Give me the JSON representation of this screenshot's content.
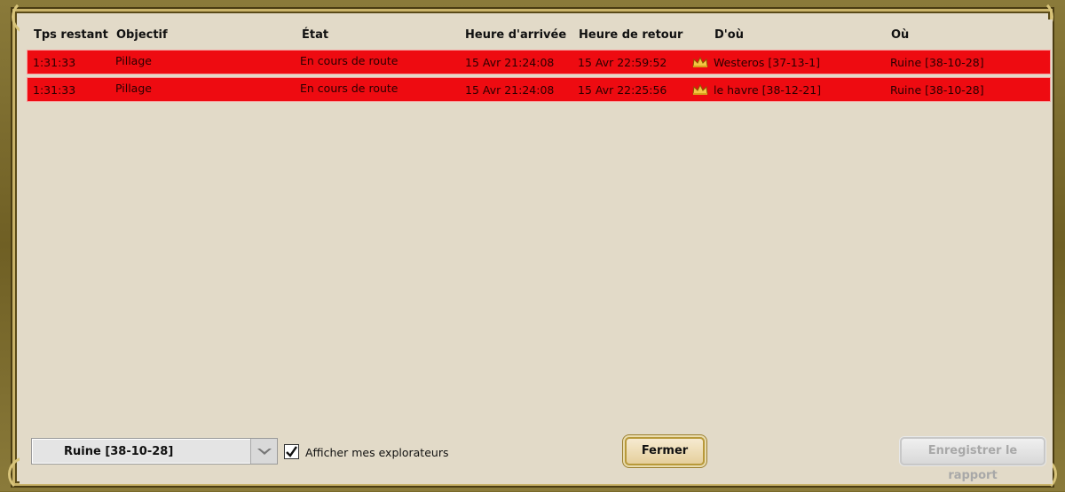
{
  "table": {
    "headers": {
      "tps": "Tps restant",
      "objectif": "Objectif",
      "etat": "État",
      "arrivee": "Heure d'arrivée",
      "retour": "Heure de retour",
      "from": "D'où",
      "to": "Où"
    },
    "rows": [
      {
        "tps": "1:31:33",
        "objectif": "Pillage",
        "etat": "En cours de route",
        "arrivee": "15 Avr 21:24:08",
        "retour": "15 Avr 22:59:52",
        "from": "Westeros [37-13-1]",
        "to": "Ruine [38-10-28]"
      },
      {
        "tps": "1:31:33",
        "objectif": "Pillage",
        "etat": "En cours de route",
        "arrivee": "15 Avr 21:24:08",
        "retour": "15 Avr 22:25:56",
        "from": "le havre [38-12-21]",
        "to": "Ruine [38-10-28]"
      }
    ],
    "row_color": "#ee0b11"
  },
  "footer": {
    "select_value": "Ruine [38-10-28]",
    "checkbox_label": "Afficher mes explorateurs",
    "checkbox_checked": true,
    "close_label": "Fermer",
    "report_label": "Enregistrer le rapport"
  },
  "icons": {
    "row_icon": "crown-icon",
    "select_arrow": "chevron-down-icon",
    "checkbox": "checkmark-icon"
  }
}
